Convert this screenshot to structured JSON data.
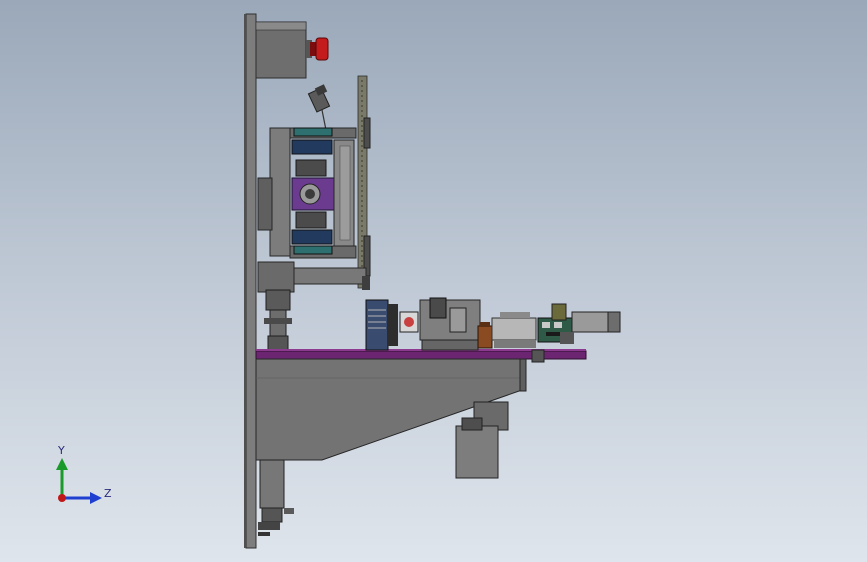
{
  "viewport": {
    "background_top": "#9aa8b9",
    "background_bottom": "#dfe5ec"
  },
  "model": {
    "frame_color": "#6b6b6b",
    "plate_color": "#6c2570",
    "dark_blue": "#233a5f",
    "teal": "#2e6f6f",
    "purple": "#6a3b8f",
    "estop_color": "#c01818",
    "brown": "#8a4b22"
  },
  "triad": {
    "y_axis_label": "Y",
    "z_axis_label": "Z",
    "y_color": "#1a9a2a",
    "z_color": "#1e3fd0",
    "origin_color": "#c01818"
  }
}
